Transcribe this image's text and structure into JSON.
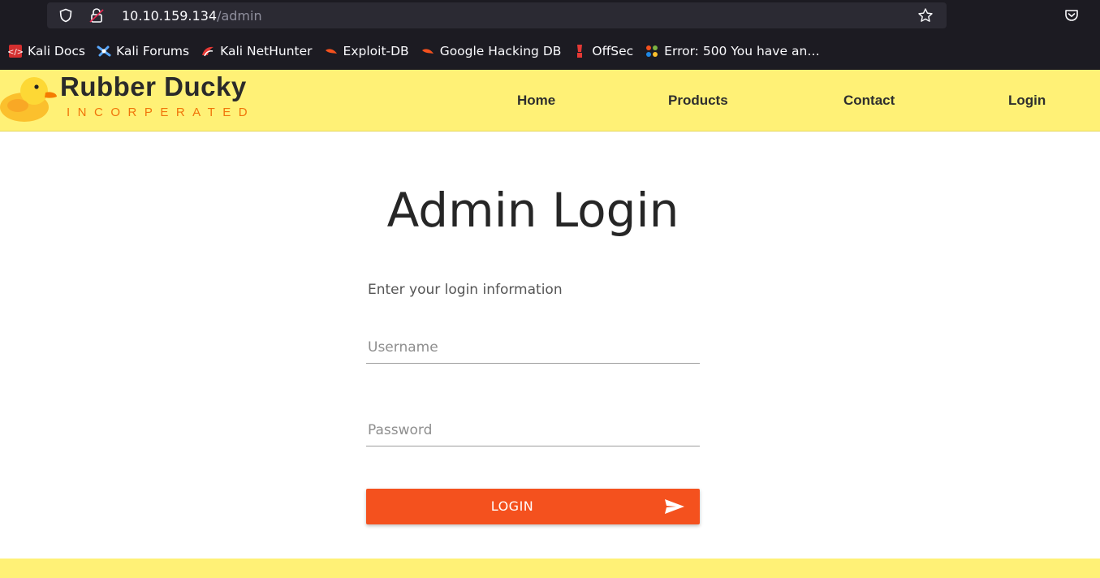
{
  "browser": {
    "url_host": "10.10.159.134",
    "url_path": "/admin",
    "bookmarks": [
      {
        "label": "Kali Docs",
        "icon": "kali-docs-icon",
        "color": "#d32f2f"
      },
      {
        "label": "Kali Forums",
        "icon": "kali-forums-icon",
        "color": "#3b82f6"
      },
      {
        "label": "Kali NetHunter",
        "icon": "kali-nethunter-icon",
        "color": "#e53935"
      },
      {
        "label": "Exploit-DB",
        "icon": "exploit-db-icon",
        "color": "#f4511e"
      },
      {
        "label": "Google Hacking DB",
        "icon": "google-hacking-db-icon",
        "color": "#f4511e"
      },
      {
        "label": "OffSec",
        "icon": "offsec-icon",
        "color": "#e53935"
      },
      {
        "label": "Error: 500 You have an…",
        "icon": "joomla-icon",
        "color": "#7cb342"
      }
    ]
  },
  "site": {
    "brand_name": "Rubber Ducky",
    "brand_sub": "INCORPERATED",
    "nav": [
      "Home",
      "Products",
      "Contact",
      "Login"
    ]
  },
  "login": {
    "title": "Admin Login",
    "subtitle": "Enter your login information",
    "username_placeholder": "Username",
    "password_placeholder": "Password",
    "button_label": "LOGIN"
  },
  "colors": {
    "header_bg": "#fff176",
    "button_bg": "#f4511e",
    "brand_sub": "#f0740a"
  }
}
